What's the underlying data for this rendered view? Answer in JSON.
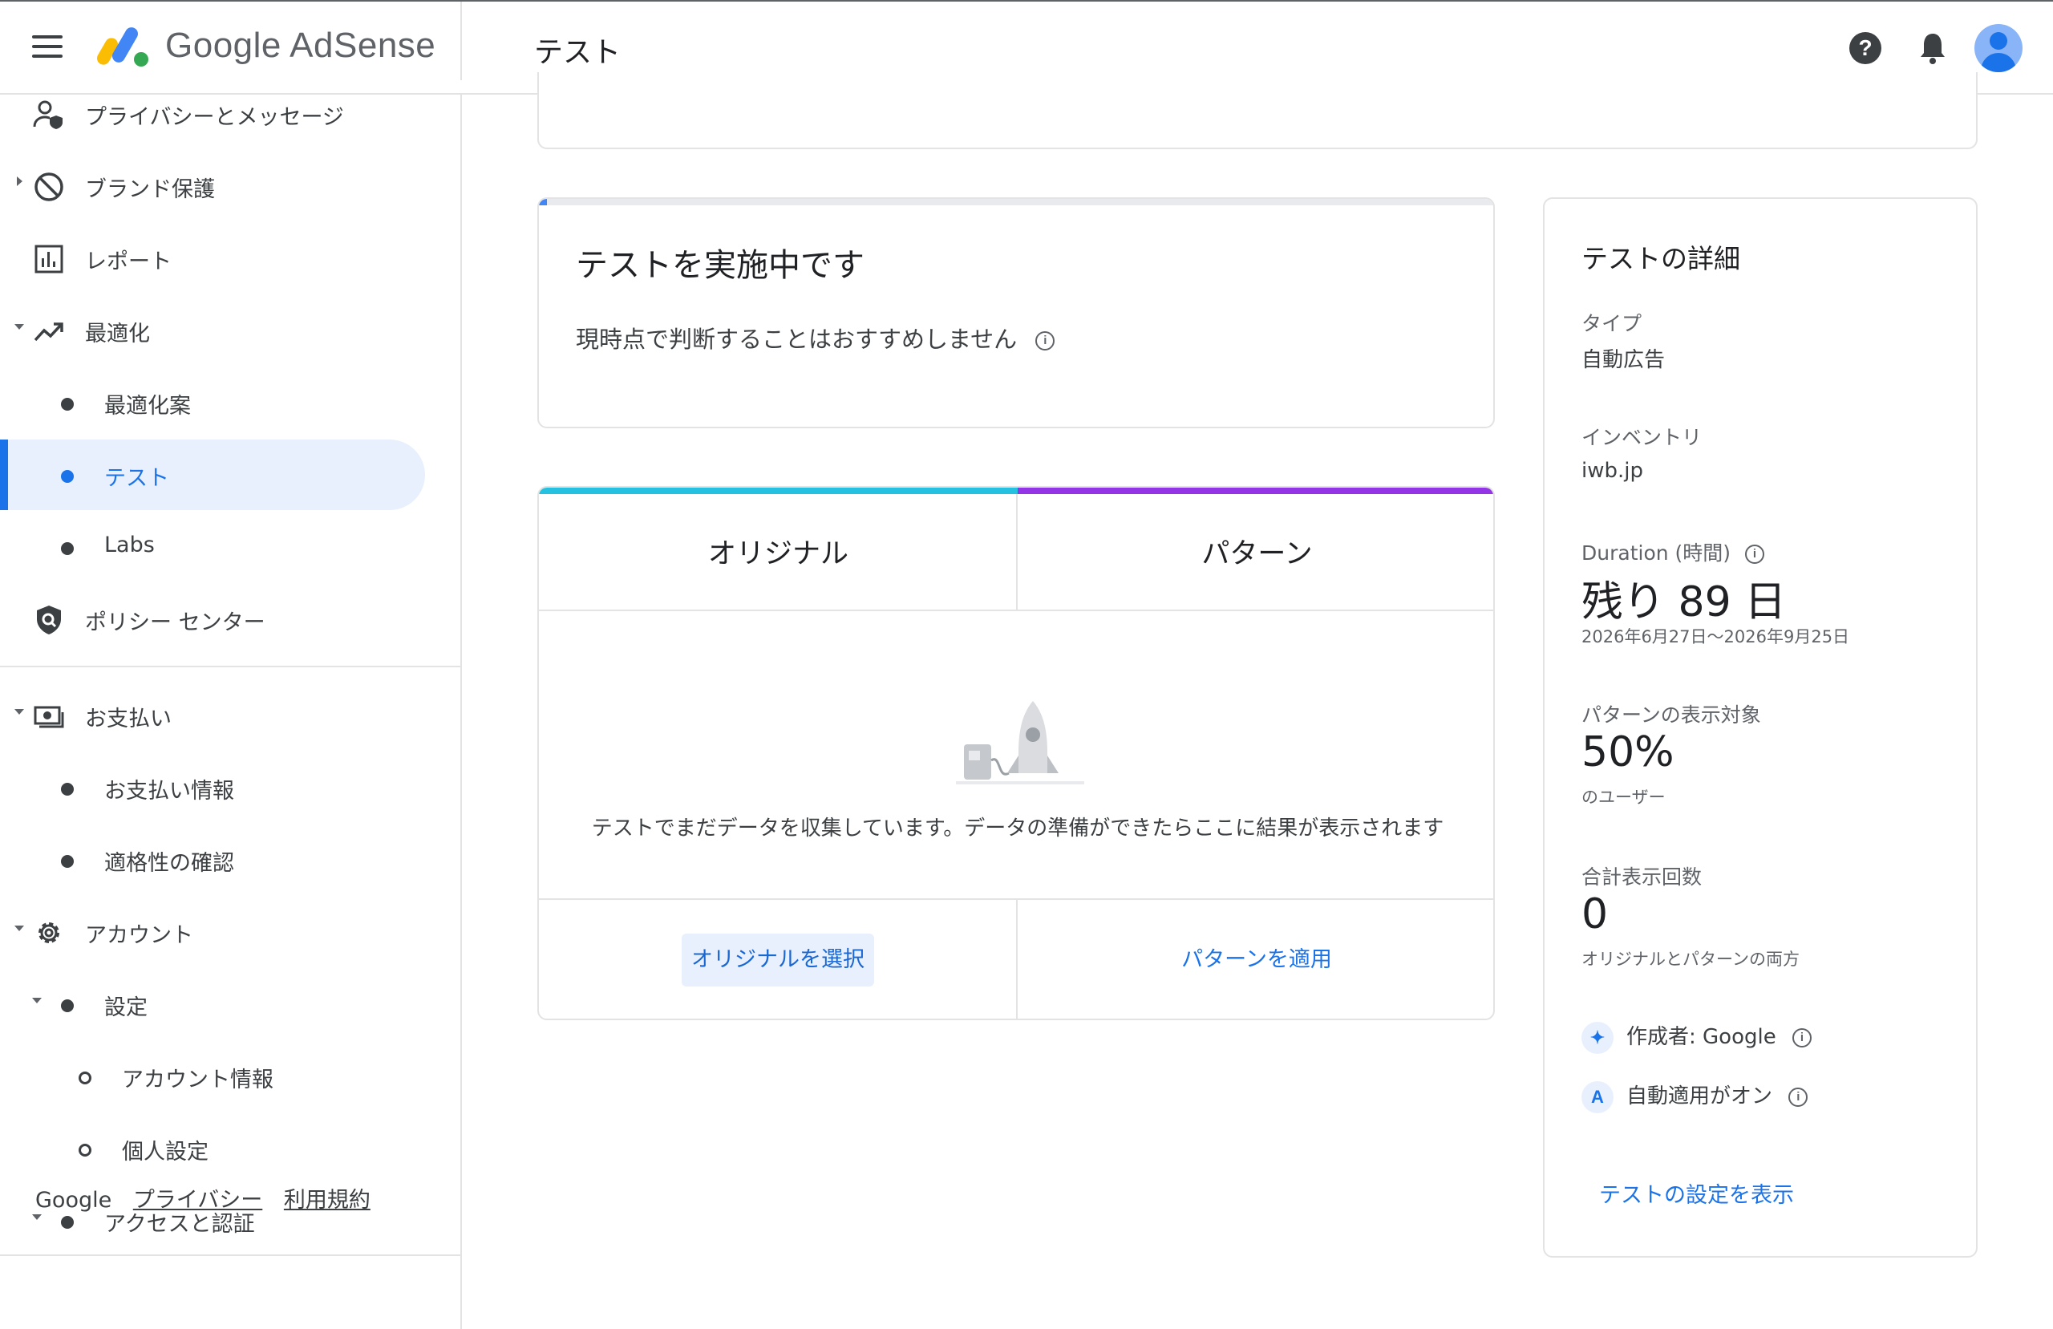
{
  "app": {
    "brand_name": "Google AdSense",
    "page_title": "テスト"
  },
  "sidebar": {
    "items": [
      {
        "label": "プライバシーとメッセージ"
      },
      {
        "label": "ブランド保護"
      },
      {
        "label": "レポート"
      },
      {
        "label": "最適化"
      },
      {
        "label": "最適化案"
      },
      {
        "label": "テスト"
      },
      {
        "label": "Labs"
      },
      {
        "label": "ポリシー センター"
      },
      {
        "label": "お支払い"
      },
      {
        "label": "お支払い情報"
      },
      {
        "label": "適格性の確認"
      },
      {
        "label": "アカウント"
      },
      {
        "label": "設定"
      },
      {
        "label": "アカウント情報"
      },
      {
        "label": "個人設定"
      },
      {
        "label": "アクセスと認証"
      }
    ],
    "footer": {
      "google": "Google",
      "privacy": "プライバシー",
      "terms": "利用規約"
    }
  },
  "status": {
    "title": "テストを実施中です",
    "subtitle": "現時点で判断することはおすすめしません"
  },
  "comparison": {
    "original_label": "オリジナル",
    "variation_label": "パターン",
    "collecting_message": "テストでまだデータを収集しています。データの準備ができたらここに結果が表示されます",
    "select_original": "オリジナルを選択",
    "apply_variation": "パターンを適用",
    "original_color": "#24c1e0",
    "variation_color": "#9334e6"
  },
  "details": {
    "title": "テストの詳細",
    "type_label": "タイプ",
    "type_value": "自動広告",
    "inventory_label": "インベントリ",
    "inventory_value": "iwb.jp",
    "duration_label": "Duration (時間)",
    "duration_value": "残り 89 日",
    "duration_range": "2026年6月27日〜2026年9月25日",
    "audience_label": "パターンの表示対象",
    "audience_value": "50%",
    "audience_unit": "のユーザー",
    "impressions_label": "合計表示回数",
    "impressions_value": "0",
    "impressions_note": "オリジナルとパターンの両方",
    "created_by": "作成者: Google",
    "auto_apply": "自動適用がオン",
    "view_settings": "テストの設定を表示"
  },
  "icons": {
    "help": "?",
    "auto_apply_letter": "A",
    "info": "i"
  },
  "colors": {
    "accent": "#1a73e8",
    "active_bg": "#e8f0fe"
  }
}
